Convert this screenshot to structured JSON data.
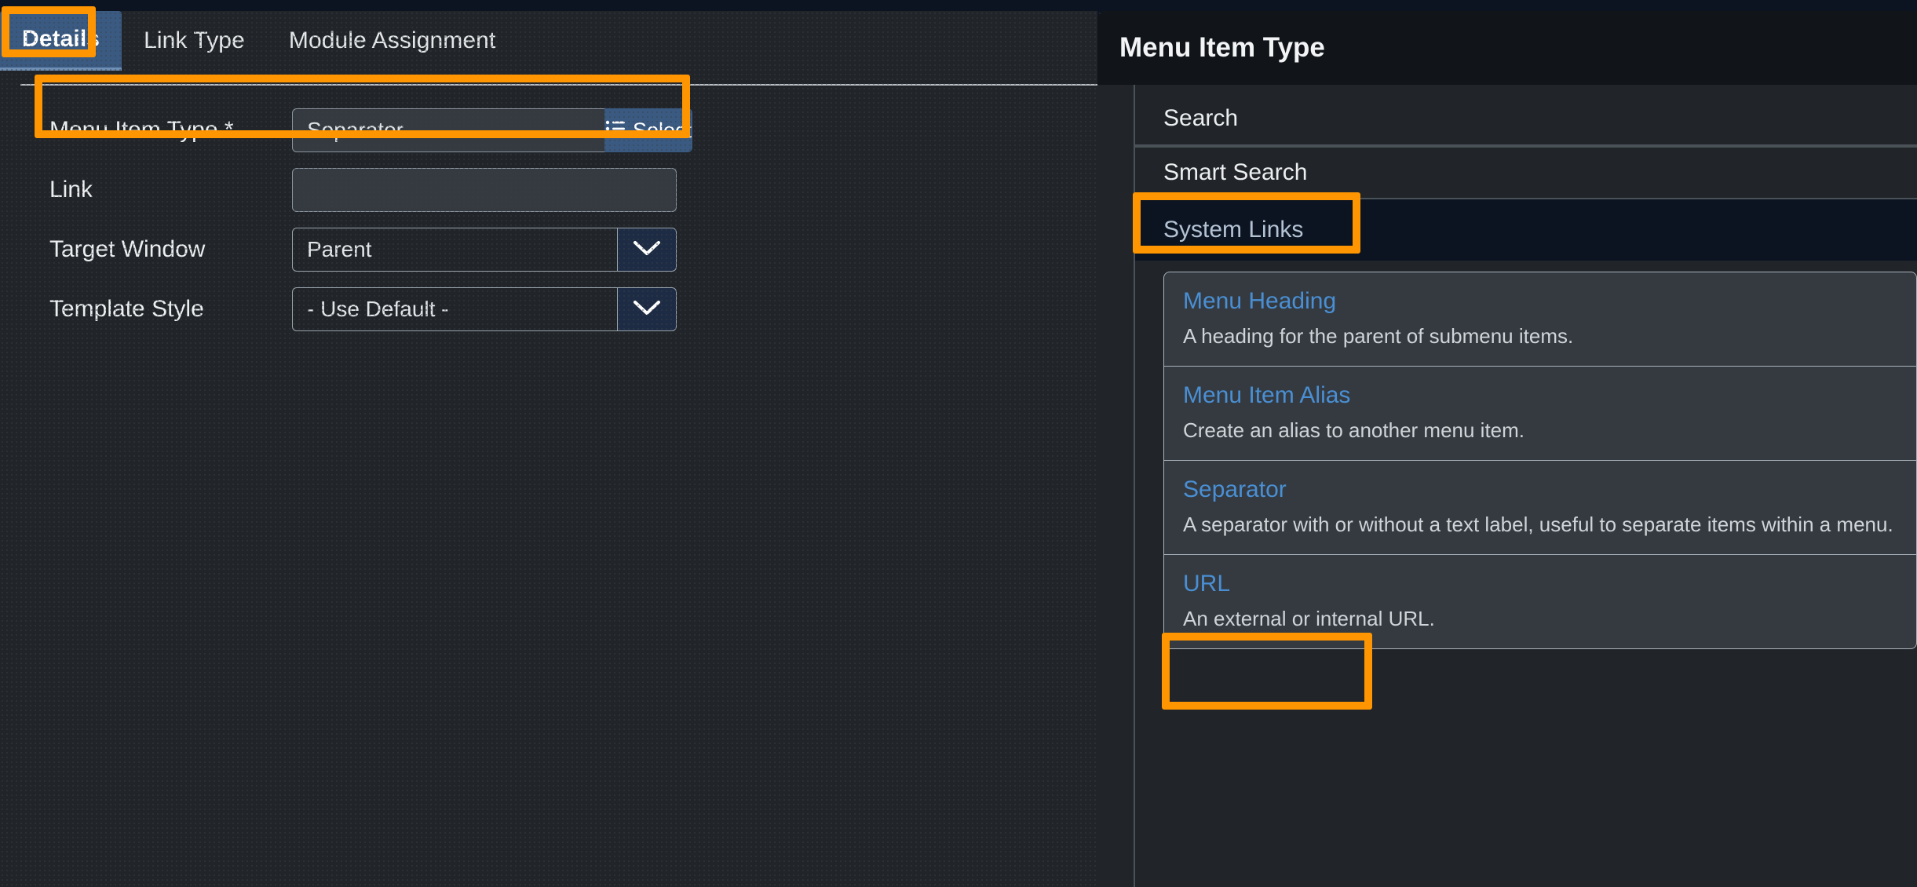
{
  "tabs": [
    {
      "label": "Details",
      "active": true
    },
    {
      "label": "Link Type",
      "active": false
    },
    {
      "label": "Module Assignment",
      "active": false
    }
  ],
  "form": {
    "menu_item_type": {
      "label": "Menu Item Type *",
      "value": "Separator",
      "button_label": "Select",
      "button_icon": "list-icon"
    },
    "link": {
      "label": "Link",
      "value": "",
      "placeholder": ""
    },
    "target_window": {
      "label": "Target Window",
      "value": "Parent",
      "icon": "chevron-down-icon"
    },
    "template_style": {
      "label": "Template Style",
      "value": "- Use Default -",
      "icon": "chevron-down-icon"
    }
  },
  "modal": {
    "title": "Menu Item Type",
    "categories": [
      {
        "label": "Search",
        "active": false
      },
      {
        "label": "Smart Search",
        "active": false
      },
      {
        "label": "System Links",
        "active": true
      }
    ],
    "cards": [
      {
        "title": "Menu Heading",
        "desc": "A heading for the parent of submenu items."
      },
      {
        "title": "Menu Item Alias",
        "desc": "Create an alias to another menu item."
      },
      {
        "title": "Separator",
        "desc": "A separator with or without a text label, useful to separate items within a menu."
      },
      {
        "title": "URL",
        "desc": "An external or internal URL."
      }
    ]
  },
  "colors": {
    "highlight": "#ff9500",
    "accent": "#3a5a82",
    "link": "#4a8fd4",
    "surface": "#212529",
    "panel_header": "#111418",
    "selected_row": "#0c1422"
  }
}
